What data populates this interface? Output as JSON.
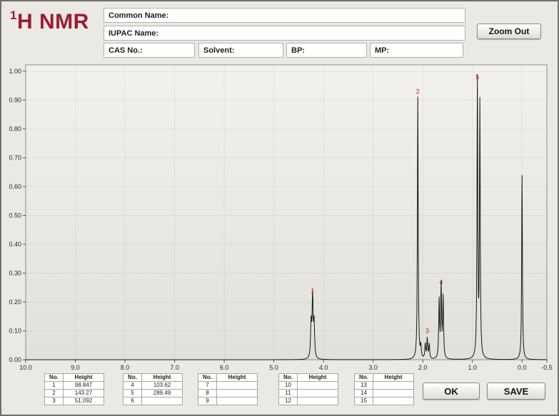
{
  "header": {
    "title_sup": "1",
    "title_main": "H NMR",
    "zoom_out_label": "Zoom Out",
    "fields": {
      "common_name": "Common Name:",
      "iupac_name": "IUPAC Name:",
      "cas": "CAS No.:",
      "solvent": "Solvent:",
      "bp": "BP:",
      "mp": "MP:"
    },
    "field_values": {
      "common_name": "",
      "iupac_name": "",
      "cas": "",
      "solvent": "",
      "bp": "",
      "mp": ""
    }
  },
  "chart_data": {
    "type": "line",
    "title": "",
    "xlabel": "",
    "ylabel": "",
    "xlim": [
      10.0,
      -0.5
    ],
    "ylim": [
      0.0,
      1.0
    ],
    "grid": true,
    "x_ticks": [
      "10.0",
      "9.0",
      "8.0",
      "7.0",
      "6.0",
      "5.0",
      "4.0",
      "3.0",
      "2.0",
      "1.0",
      "0.0",
      "-0.5"
    ],
    "y_ticks": [
      "0.00",
      "0.10",
      "0.20",
      "0.30",
      "0.40",
      "0.50",
      "0.60",
      "0.70",
      "0.80",
      "0.90",
      "1.00"
    ],
    "peaks": [
      {
        "label": "1",
        "ppm": 4.22,
        "height": 0.22
      },
      {
        "label": "2",
        "ppm": 2.1,
        "height": 0.91
      },
      {
        "label": "3",
        "ppm": 1.91,
        "height": 0.08
      },
      {
        "label": "4",
        "ppm": 1.63,
        "height": 0.25
      },
      {
        "label": "5",
        "ppm": 0.9,
        "height": 0.96
      }
    ],
    "reference_peak": {
      "ppm": 0.0,
      "height": 0.64
    },
    "lines": [
      {
        "ppm": 4.25,
        "h": 0.12,
        "w": 0.012
      },
      {
        "ppm": 4.22,
        "h": 0.21,
        "w": 0.012
      },
      {
        "ppm": 4.19,
        "h": 0.12,
        "w": 0.012
      },
      {
        "ppm": 2.1,
        "h": 0.91,
        "w": 0.009
      },
      {
        "ppm": 2.04,
        "h": 0.04,
        "w": 0.01
      },
      {
        "ppm": 1.95,
        "h": 0.05,
        "w": 0.01
      },
      {
        "ppm": 1.91,
        "h": 0.07,
        "w": 0.01
      },
      {
        "ppm": 1.87,
        "h": 0.05,
        "w": 0.01
      },
      {
        "ppm": 1.67,
        "h": 0.2,
        "w": 0.01
      },
      {
        "ppm": 1.63,
        "h": 0.25,
        "w": 0.01
      },
      {
        "ppm": 1.59,
        "h": 0.21,
        "w": 0.01
      },
      {
        "ppm": 0.9,
        "h": 0.96,
        "w": 0.009
      },
      {
        "ppm": 0.85,
        "h": 0.88,
        "w": 0.009
      },
      {
        "ppm": 0.0,
        "h": 0.64,
        "w": 0.009
      }
    ]
  },
  "tables": [
    {
      "headers": [
        "No.",
        "Height"
      ],
      "rows": [
        [
          "1",
          "98.847"
        ],
        [
          "2",
          "143.27"
        ],
        [
          "3",
          "51.092"
        ]
      ]
    },
    {
      "headers": [
        "No.",
        "Height"
      ],
      "rows": [
        [
          "4",
          "103.62"
        ],
        [
          "5",
          "289.49"
        ],
        [
          "6",
          ""
        ]
      ]
    },
    {
      "headers": [
        "No.",
        "Height"
      ],
      "rows": [
        [
          "7",
          ""
        ],
        [
          "8",
          ""
        ],
        [
          "9",
          ""
        ]
      ]
    },
    {
      "headers": [
        "No.",
        "Height"
      ],
      "rows": [
        [
          "10",
          ""
        ],
        [
          "11",
          ""
        ],
        [
          "12",
          ""
        ]
      ]
    },
    {
      "headers": [
        "No.",
        "Height"
      ],
      "rows": [
        [
          "13",
          ""
        ],
        [
          "14",
          ""
        ],
        [
          "15",
          ""
        ]
      ]
    }
  ],
  "buttons": {
    "ok": "OK",
    "save": "SAVE"
  }
}
